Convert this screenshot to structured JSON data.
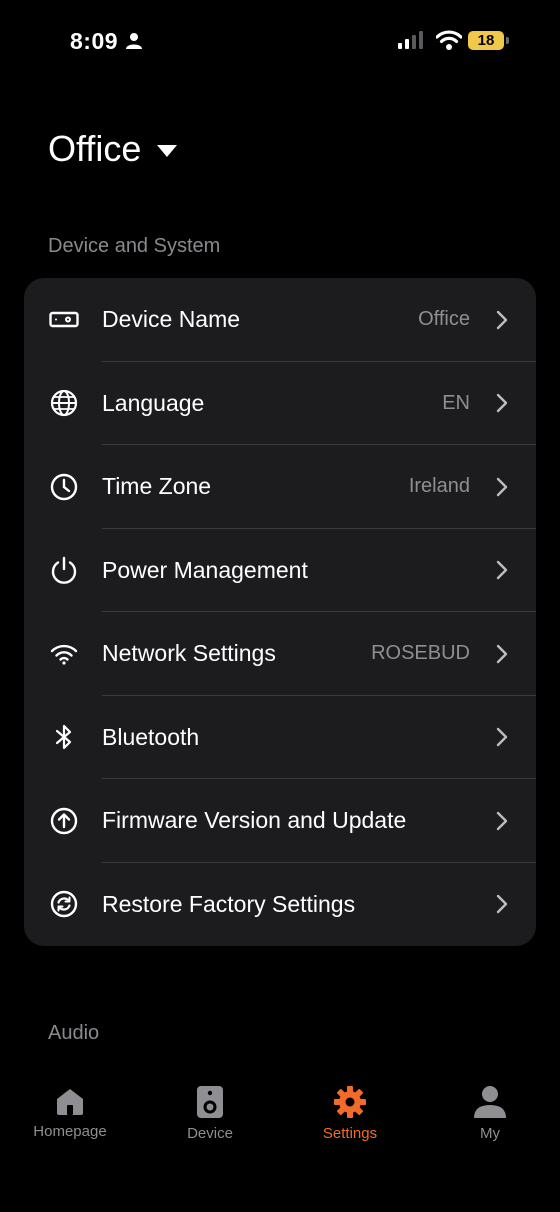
{
  "status_bar": {
    "time": "8:09",
    "battery": "18"
  },
  "header": {
    "title": "Office"
  },
  "sections": {
    "device_system": "Device and System",
    "audio": "Audio"
  },
  "settings": [
    {
      "label": "Device Name",
      "value": "Office",
      "icon": "device-icon"
    },
    {
      "label": "Language",
      "value": "EN",
      "icon": "globe-icon"
    },
    {
      "label": "Time Zone",
      "value": "Ireland",
      "icon": "clock-icon"
    },
    {
      "label": "Power Management",
      "value": "",
      "icon": "power-icon"
    },
    {
      "label": "Network Settings",
      "value": "ROSEBUD",
      "icon": "wifi-icon"
    },
    {
      "label": "Bluetooth",
      "value": "",
      "icon": "bluetooth-icon"
    },
    {
      "label": "Firmware Version and Update",
      "value": "",
      "icon": "upload-icon"
    },
    {
      "label": "Restore Factory Settings",
      "value": "",
      "icon": "restore-icon"
    }
  ],
  "tabs": [
    {
      "label": "Homepage",
      "icon": "home-icon",
      "active": false
    },
    {
      "label": "Device",
      "icon": "speaker-icon",
      "active": false
    },
    {
      "label": "Settings",
      "icon": "gear-icon",
      "active": true
    },
    {
      "label": "My",
      "icon": "person-icon",
      "active": false
    }
  ],
  "colors": {
    "accent": "#f26b2a",
    "card": "#1c1c1e",
    "background": "#000000"
  }
}
